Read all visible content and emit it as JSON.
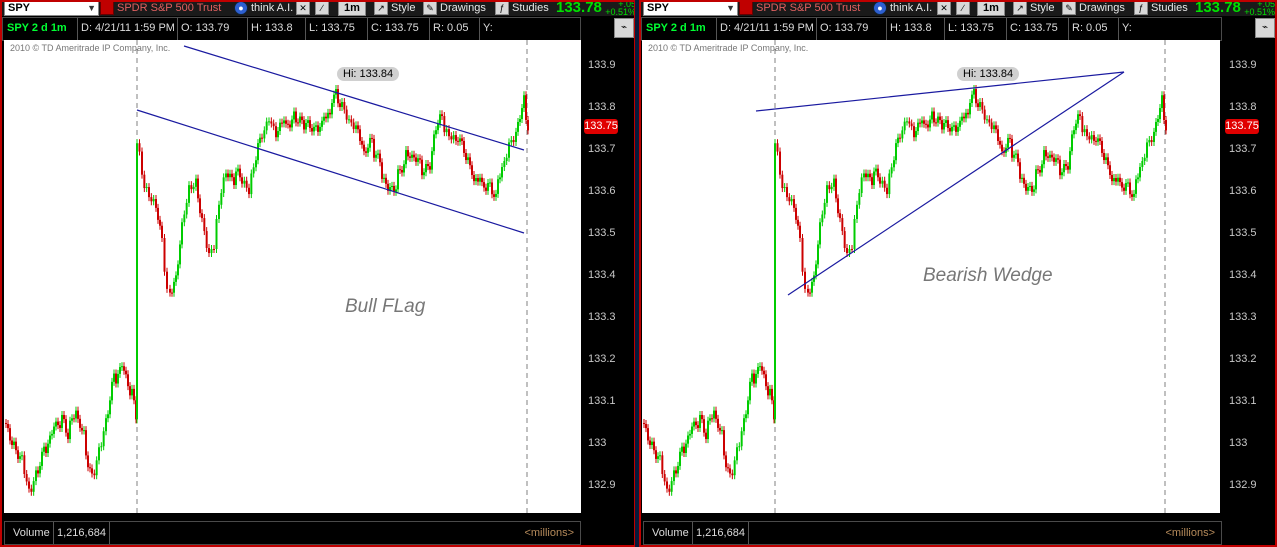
{
  "panels": [
    {
      "toolbar": {
        "symbol": "SPY",
        "security_name": "SPDR S&P 500 Trust",
        "think_ai_label": "think A.I.",
        "interval_label": "1m",
        "style_label": "Style",
        "drawings_label": "Drawings",
        "studies_label": "Studies",
        "last_price": "133.78",
        "change_top": "+.05",
        "change_pct": "+0.51%"
      },
      "header": {
        "chart_symbol": "SPY 2 d 1m",
        "date": "D: 4/21/11 1:59 PM",
        "open": "O: 133.79",
        "high": "H: 133.8",
        "low": "L: 133.75",
        "close": "C: 133.75",
        "range": "R: 0.05",
        "y": "Y:"
      },
      "copyright": "2010 © TD Ameritrade IP Company, Inc.",
      "hi_label": "Hi: 133.84",
      "pattern_label": "Bull FLag",
      "current_price_tag": "133.75",
      "y_ticks": [
        "133.9",
        "133.8",
        "133.7",
        "133.6",
        "133.5",
        "133.4",
        "133.3",
        "133.2",
        "133.1",
        "133",
        "132.9"
      ],
      "volume": {
        "label": "Volume",
        "value": "1,216,684",
        "units": "<millions>"
      }
    },
    {
      "toolbar": {
        "symbol": "SPY",
        "security_name": "SPDR S&P 500 Trust",
        "think_ai_label": "think A.I.",
        "interval_label": "1m",
        "style_label": "Style",
        "drawings_label": "Drawings",
        "studies_label": "Studies",
        "last_price": "133.78",
        "change_top": "+.05",
        "change_pct": "+0.51%"
      },
      "header": {
        "chart_symbol": "SPY 2 d 1m",
        "date": "D: 4/21/11 1:59 PM",
        "open": "O: 133.79",
        "high": "H: 133.8",
        "low": "L: 133.75",
        "close": "C: 133.75",
        "range": "R: 0.05",
        "y": "Y:"
      },
      "copyright": "2010 © TD Ameritrade IP Company, Inc.",
      "hi_label": "Hi: 133.84",
      "pattern_label": "Bearish Wedge",
      "current_price_tag": "133.75",
      "y_ticks": [
        "133.9",
        "133.8",
        "133.7",
        "133.6",
        "133.5",
        "133.4",
        "133.3",
        "133.2",
        "133.1",
        "133",
        "132.9"
      ],
      "volume": {
        "label": "Volume",
        "value": "1,216,684",
        "units": "<millions>"
      }
    }
  ],
  "colors": {
    "up": "#00cc00",
    "down": "#cc0000",
    "trendline": "#1a1aa0",
    "session_line": "#808080",
    "price_tag": "#e00000",
    "last_price": "#00e000"
  }
}
